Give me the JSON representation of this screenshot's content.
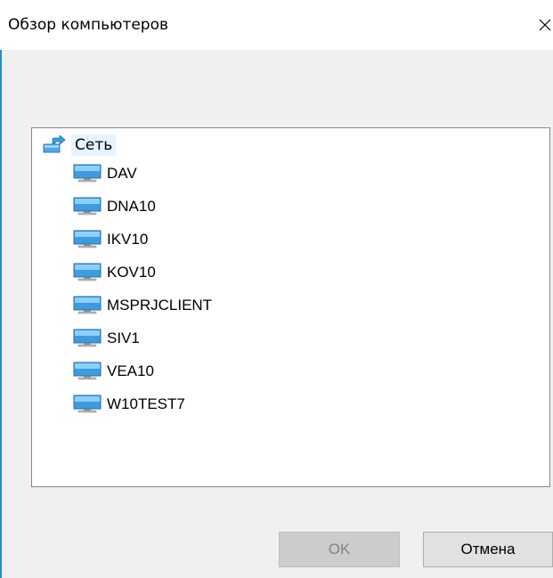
{
  "dialog": {
    "title": "Обзор компьютеров",
    "close_glyph": "✕"
  },
  "tree": {
    "root": {
      "label": "Сеть",
      "icon": "network-icon",
      "selected": true
    },
    "items": [
      {
        "label": "DAV",
        "icon": "computer-icon"
      },
      {
        "label": "DNA10",
        "icon": "computer-icon"
      },
      {
        "label": "IKV10",
        "icon": "computer-icon"
      },
      {
        "label": "KOV10",
        "icon": "computer-icon"
      },
      {
        "label": "MSPRJCLIENT",
        "icon": "computer-icon"
      },
      {
        "label": "SIV1",
        "icon": "computer-icon"
      },
      {
        "label": "VEA10",
        "icon": "computer-icon"
      },
      {
        "label": "W10TEST7",
        "icon": "computer-icon"
      }
    ]
  },
  "buttons": {
    "ok_label": "OK",
    "ok_enabled": false,
    "cancel_label": "Отмена"
  },
  "colors": {
    "selection_bg": "#e5f3ff",
    "window_bg": "#f0f0f0",
    "accent_edge": "#1c8fd6"
  }
}
